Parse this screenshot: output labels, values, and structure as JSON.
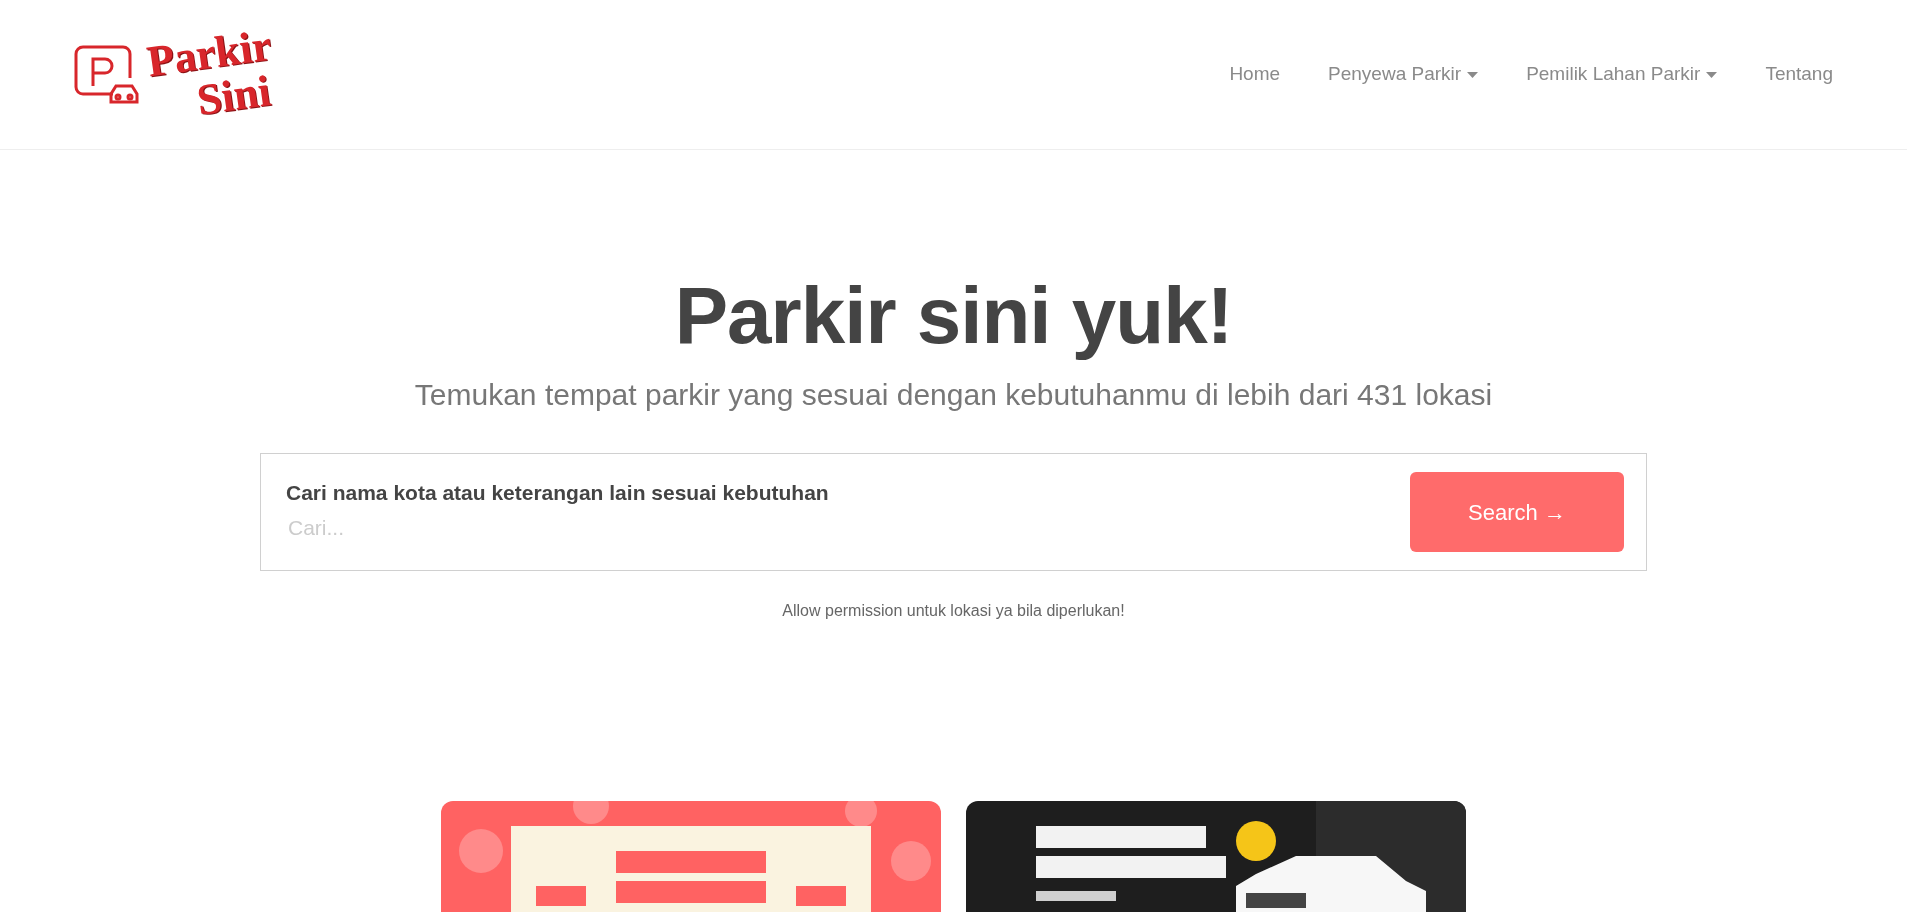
{
  "navbar": {
    "logo": {
      "line_1": "Parkir",
      "line_2": "Sini"
    },
    "links": [
      {
        "label": "Home",
        "dropdown": false
      },
      {
        "label": "Penyewa Parkir",
        "dropdown": true
      },
      {
        "label": "Pemilik Lahan Parkir",
        "dropdown": true
      },
      {
        "label": "Tentang",
        "dropdown": false
      }
    ]
  },
  "hero": {
    "title": "Parkir sini yuk!",
    "subtitle": "Temukan tempat parkir yang sesuai dengan kebutuhanmu di lebih dari 431 lokasi"
  },
  "search": {
    "label": "Cari nama kota atau keterangan lain sesuai kebutuhan",
    "placeholder": "Cari...",
    "button": "Search →"
  },
  "note": "Allow permission untuk lokasi ya bila diperlukan!"
}
